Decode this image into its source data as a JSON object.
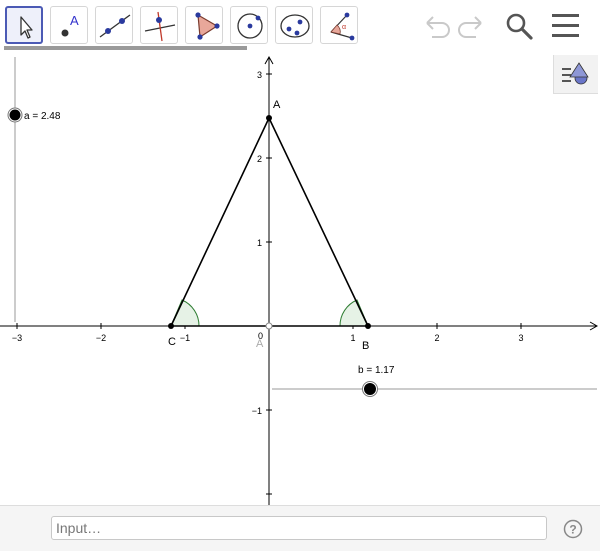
{
  "toolbar": {
    "tools": [
      {
        "name": "move-tool-icon",
        "selected": true
      },
      {
        "name": "point-tool-icon",
        "glyph": "A"
      },
      {
        "name": "line-tool-icon"
      },
      {
        "name": "perpendicular-line-tool-icon"
      },
      {
        "name": "polygon-tool-icon"
      },
      {
        "name": "circle-tool-icon"
      },
      {
        "name": "ellipse-tool-icon"
      },
      {
        "name": "angle-tool-icon",
        "glyph": "α"
      }
    ],
    "buttons": [
      "undo-icon",
      "redo-icon",
      "search-icon",
      "menu-icon"
    ]
  },
  "graph": {
    "x_ticks": [
      "−3",
      "−2",
      "−1",
      "1",
      "2",
      "3"
    ],
    "y_ticks": [
      "3",
      "2",
      "1",
      "−1"
    ],
    "origin_label": "0",
    "points": {
      "A": "A",
      "B": "B",
      "C": "C"
    },
    "sliders": {
      "a_label": "a = 2.48",
      "b_label": "b = 1.17"
    },
    "colors": {
      "triangle_stroke": "#000000",
      "angle_fill": "#e6f2e6",
      "angle_stroke": "#2e7d32",
      "axis": "#000000",
      "slider_knob": "#000000"
    }
  },
  "input": {
    "placeholder": "Input…"
  },
  "help": {
    "icon": "help-icon"
  }
}
